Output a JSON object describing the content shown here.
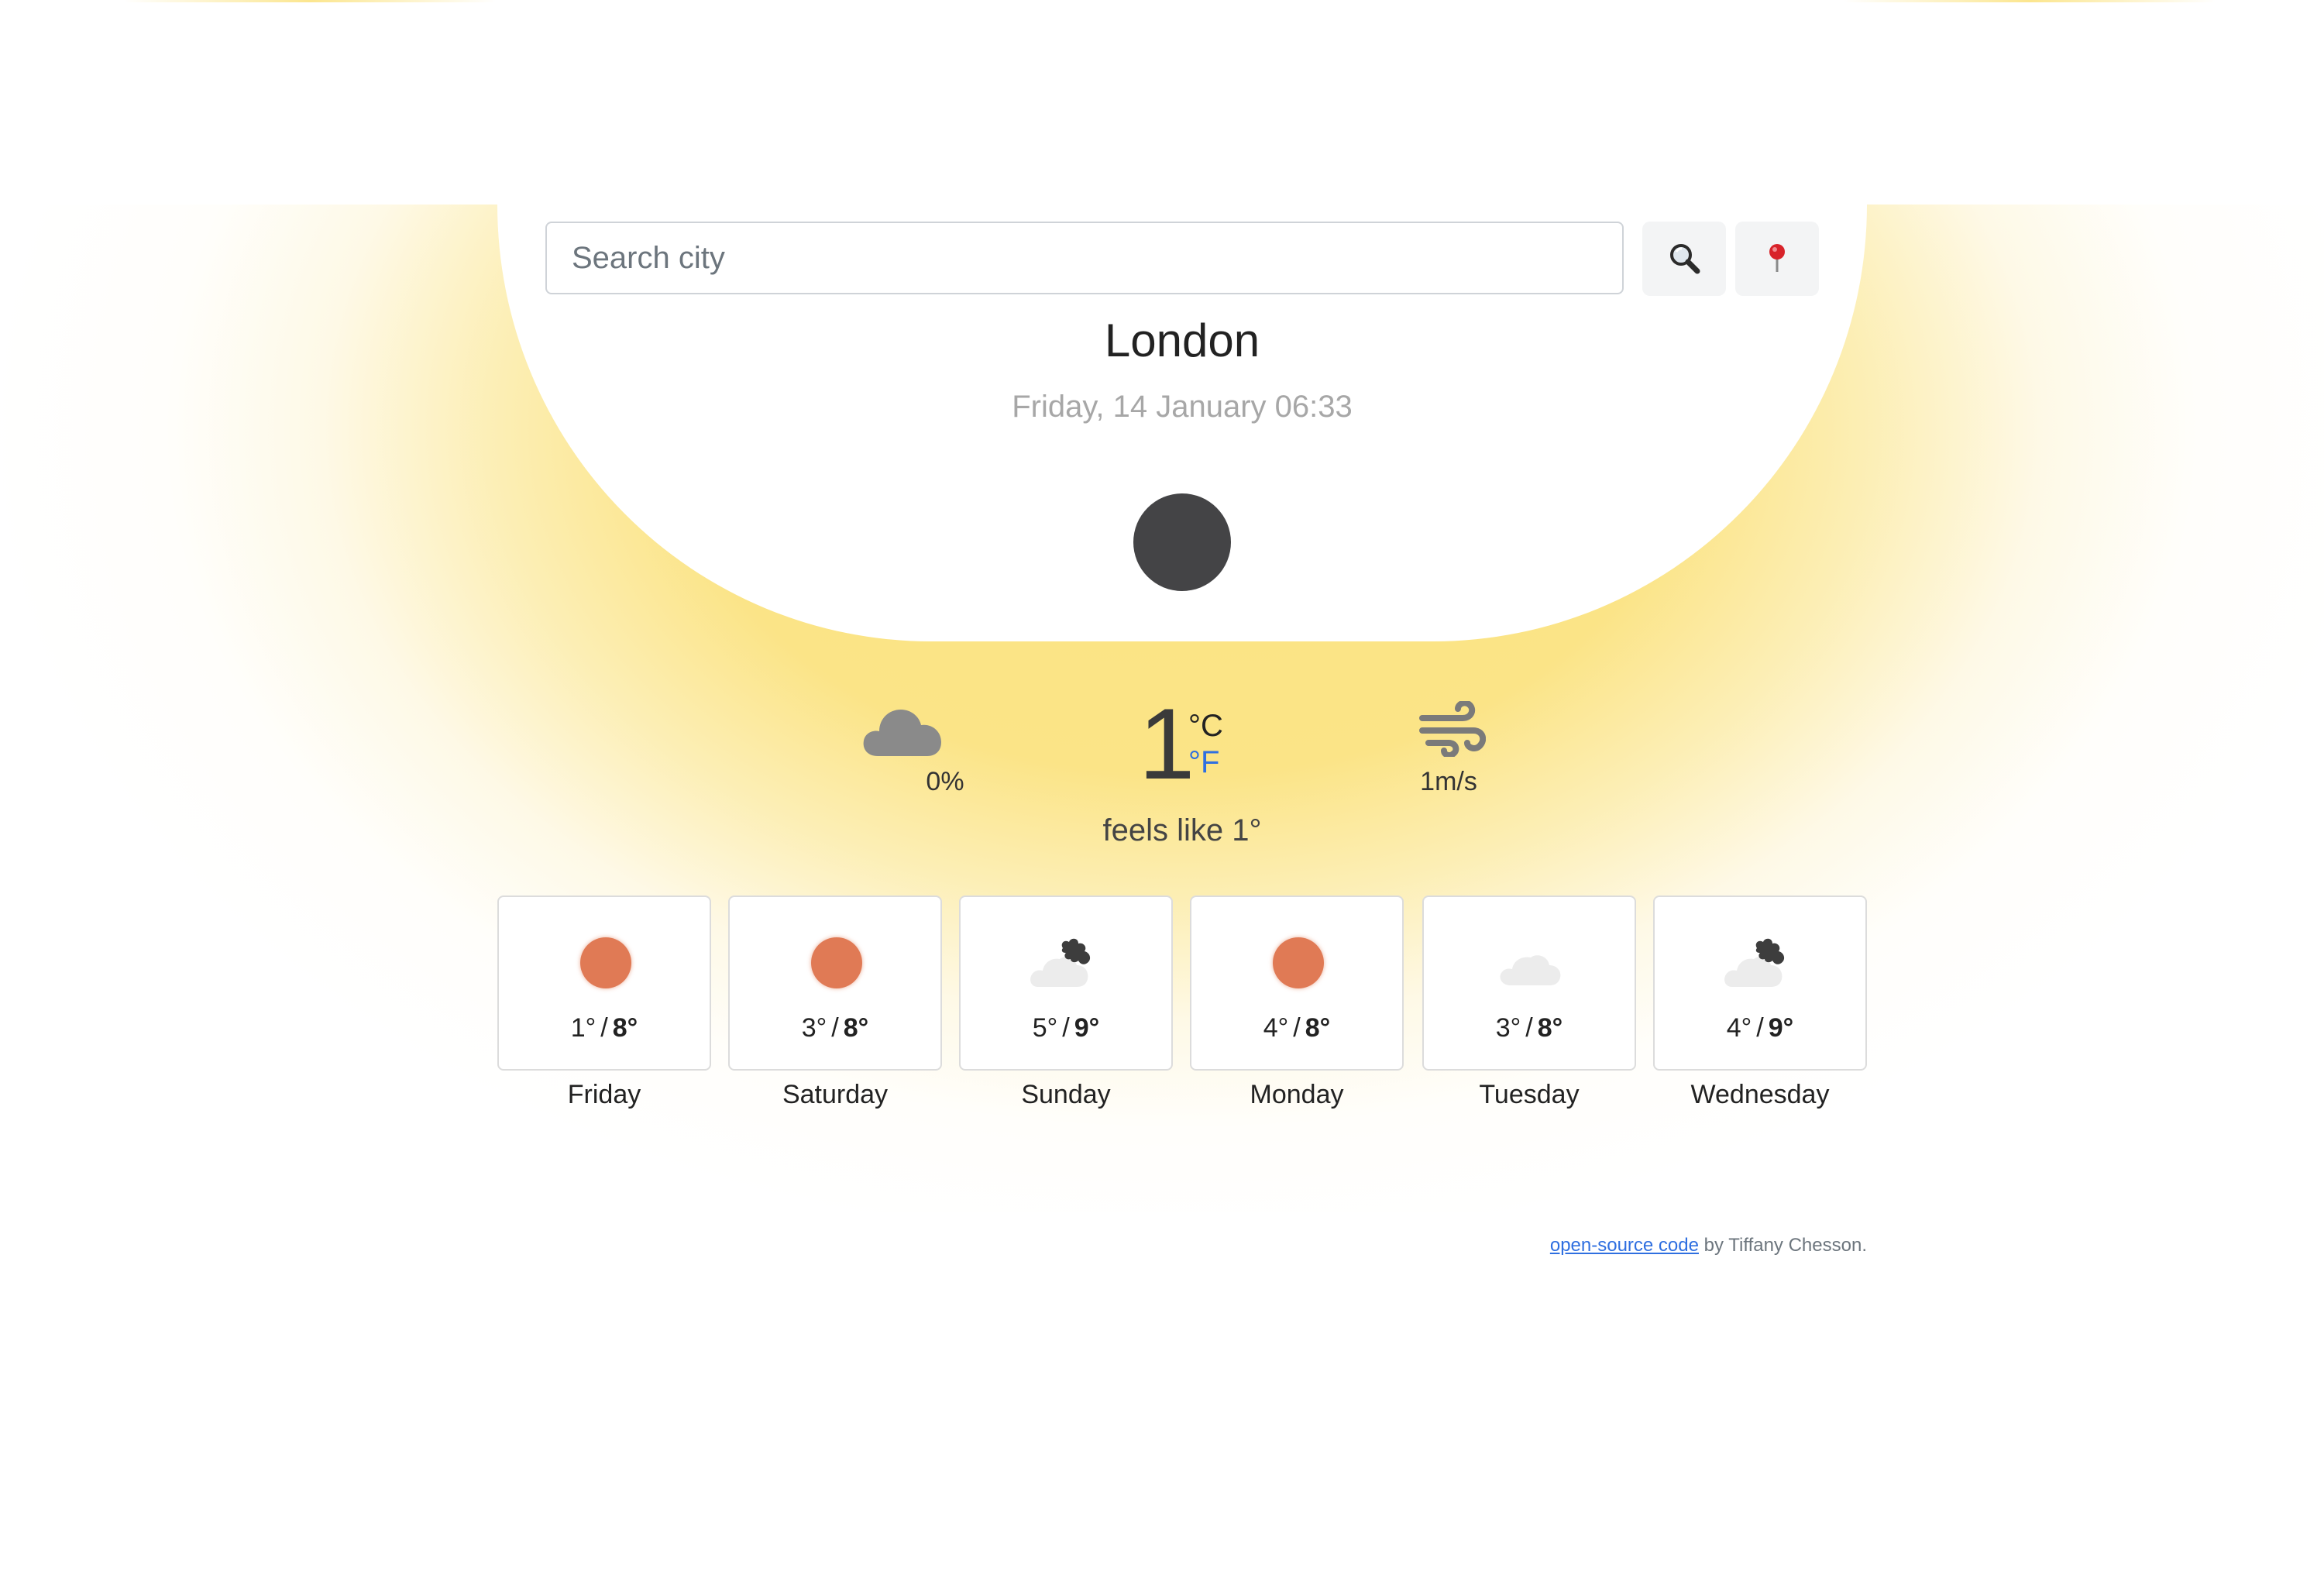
{
  "search": {
    "placeholder": "Search city"
  },
  "buttons": {
    "search_icon": "magnifying-glass-icon",
    "location_icon": "map-pin-icon"
  },
  "location": {
    "city": "London",
    "datetime": "Friday, 14 January 06:33"
  },
  "current": {
    "condition_icon": "moon-icon",
    "cloud_cover": "0%",
    "temperature": "1",
    "unit_celsius": "°C",
    "unit_fahrenheit": "°F",
    "feels_like": "feels like 1°",
    "wind_speed": "1m/s"
  },
  "forecast": [
    {
      "day": "Friday",
      "low": "1°",
      "high": "8°",
      "icon": "sun-icon"
    },
    {
      "day": "Saturday",
      "low": "3°",
      "high": "8°",
      "icon": "sun-icon"
    },
    {
      "day": "Sunday",
      "low": "5°",
      "high": "9°",
      "icon": "cloud-rain-icon"
    },
    {
      "day": "Monday",
      "low": "4°",
      "high": "8°",
      "icon": "sun-icon"
    },
    {
      "day": "Tuesday",
      "low": "3°",
      "high": "8°",
      "icon": "cloud-icon"
    },
    {
      "day": "Wednesday",
      "low": "4°",
      "high": "9°",
      "icon": "cloud-rain-icon"
    }
  ],
  "footer": {
    "link_text": "open-source code",
    "credit": " by Tiffany Chesson."
  },
  "colors": {
    "glow": "#fbe382",
    "sun": "#e07a55",
    "moon": "#444446",
    "fahrenheit_link": "#2f6fe0"
  }
}
